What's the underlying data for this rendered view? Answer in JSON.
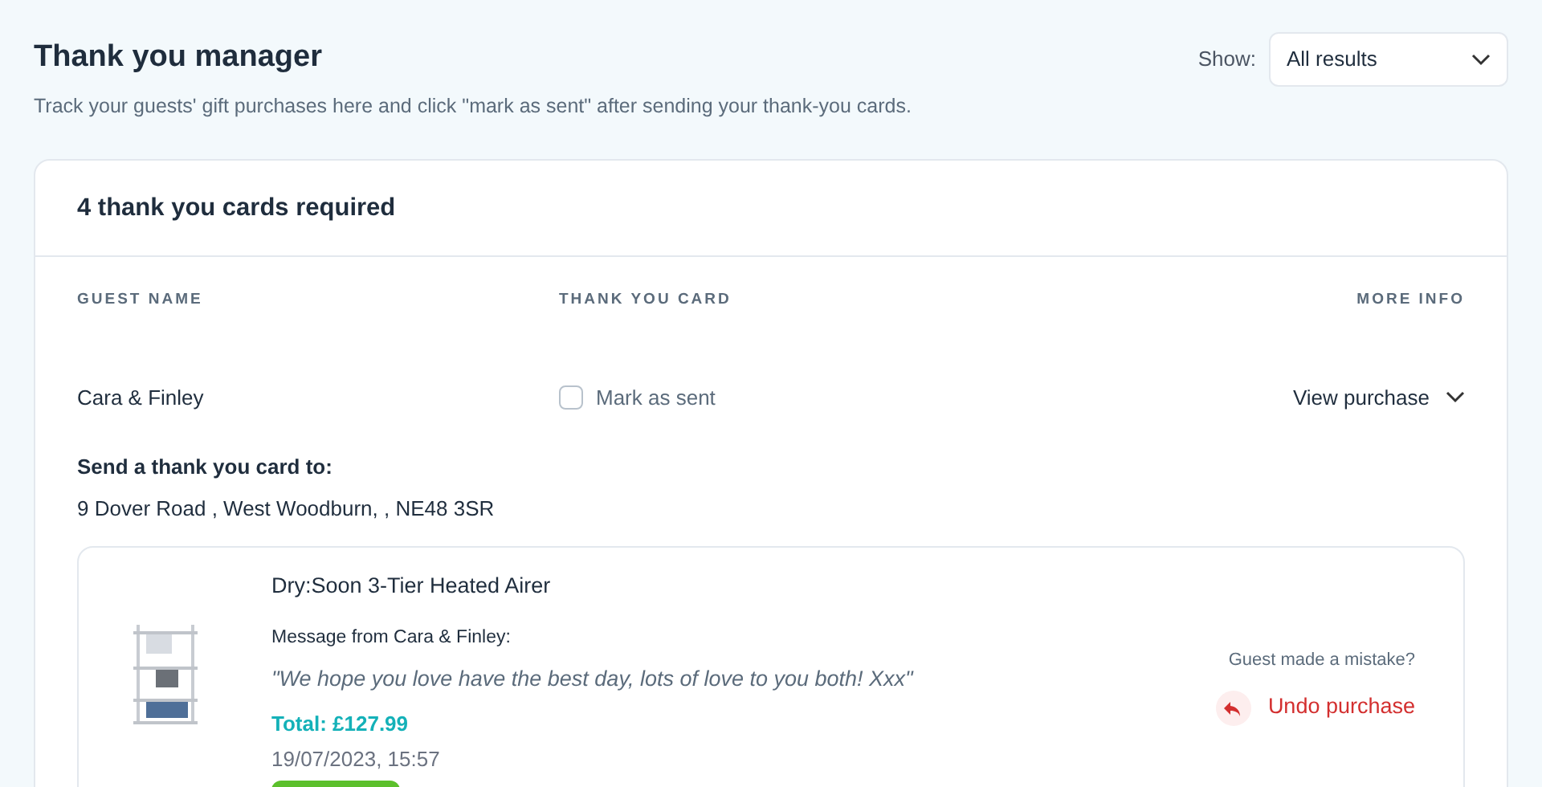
{
  "header": {
    "title": "Thank you manager",
    "subtitle": "Track your guests' gift purchases here and click \"mark as sent\" after sending your thank-you cards.",
    "filter": {
      "label": "Show:",
      "value": "All results"
    }
  },
  "card": {
    "title": "4 thank you cards required",
    "columns": [
      "GUEST NAME",
      "THANK YOU CARD",
      "MORE INFO"
    ],
    "guests": [
      {
        "name": "Cara & Finley",
        "mark_label": "Mark as sent",
        "checked": false,
        "more_label": "View purchase",
        "expanded": true,
        "address_label": "Send a thank you card to:",
        "address": "9 Dover Road , West Woodburn, , NE48 3SR",
        "purchase": {
          "product": "Dry:Soon 3-Tier Heated Airer",
          "message_label": "Message from Cara & Finley:",
          "message": "\"We hope you love have the best day, lots of love to you both! Xxx\"",
          "total": "Total: £127.99",
          "date": "19/07/2023, 15:57",
          "mistake_label": "Guest made a mistake?",
          "undo_label": "Undo purchase"
        }
      }
    ]
  }
}
